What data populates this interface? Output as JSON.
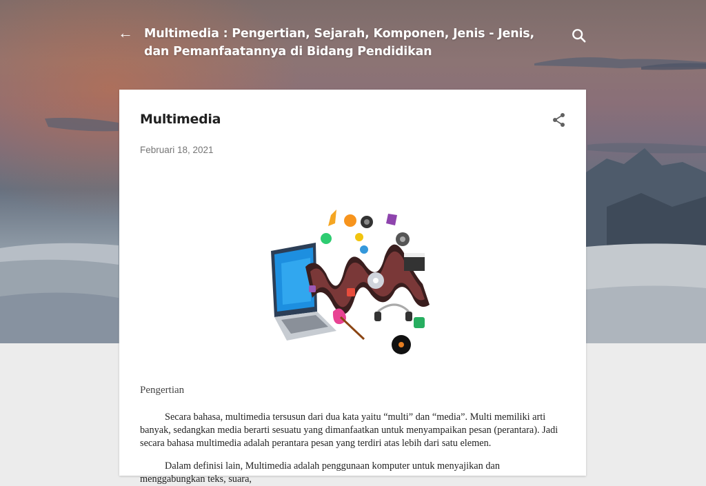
{
  "header": {
    "title": "Multimedia : Pengertian, Sejarah, Komponen, Jenis - Jenis, dan Pemanfaatannya di Bidang Pendidikan",
    "back_icon": "arrow-left-icon",
    "search_icon": "search-icon"
  },
  "post": {
    "title": "Multimedia",
    "date": "Februari 18, 2021",
    "share_icon": "share-icon",
    "image_alt": "multimedia-illustration",
    "section_heading": "Pengertian",
    "paragraphs": [
      "Secara bahasa, multimedia tersusun dari dua kata yaitu “multi” dan “media”. Multi memiliki arti banyak, sedangkan media berarti sesuatu yang dimanfaatkan untuk menyampaikan pesan (perantara).  Jadi secara bahasa multimedia adalah perantara pesan yang terdiri atas lebih dari satu elemen.",
      "Dalam definisi lain, Multimedia adalah penggunaan komputer untuk menyajikan dan menggabungkan teks, suara,"
    ]
  },
  "colors": {
    "header_text": "#ffffff",
    "card_background": "#ffffff",
    "page_background": "#ececec"
  }
}
